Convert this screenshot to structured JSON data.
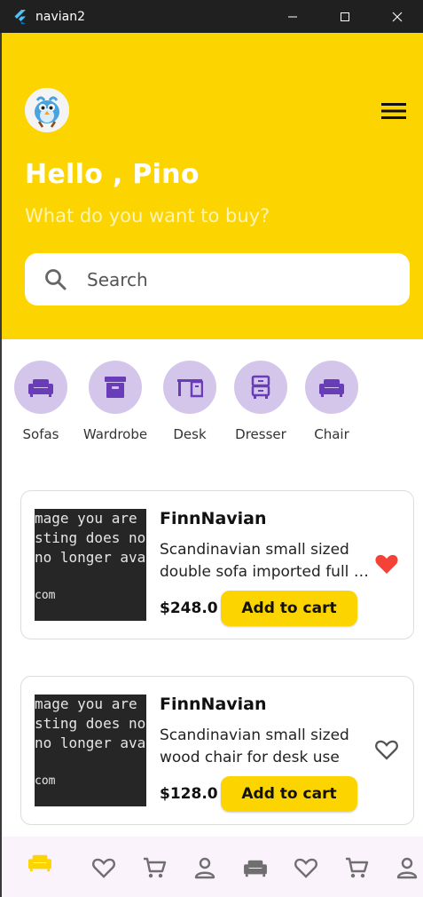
{
  "window": {
    "title": "navian2"
  },
  "header": {
    "greeting": "Hello , Pino",
    "subtitle": "What do you want to buy?",
    "search_placeholder": "Search",
    "background_color": "#FCD400"
  },
  "categories": [
    {
      "label": "Sofas",
      "icon": "sofa-icon"
    },
    {
      "label": "Wardrobe",
      "icon": "wardrobe-icon"
    },
    {
      "label": "Desk",
      "icon": "desk-icon"
    },
    {
      "label": "Dresser",
      "icon": "dresser-icon"
    },
    {
      "label": "Chair",
      "icon": "chair-icon"
    }
  ],
  "image_placeholder_text": [
    "mage you are",
    "sting does no",
    "no longer avail",
    "com"
  ],
  "products": [
    {
      "name": "FinnNavian",
      "description_lines": [
        "Scandinavian small sized",
        "double sofa imported full le..."
      ],
      "price": "$248.0",
      "cart_label": "Add to cart",
      "favorite": true
    },
    {
      "name": "FinnNavian",
      "description_lines": [
        "Scandinavian small sized",
        "wood chair for desk use"
      ],
      "price": "$128.0",
      "cart_label": "Add to cart",
      "favorite": false
    }
  ],
  "bottom_nav": [
    {
      "icon": "sofa-icon",
      "active": true
    },
    {
      "icon": "heart-icon",
      "active": false
    },
    {
      "icon": "cart-icon",
      "active": false
    },
    {
      "icon": "person-icon",
      "active": false
    },
    {
      "icon": "sofa-icon",
      "active": false
    },
    {
      "icon": "heart-icon",
      "active": false
    },
    {
      "icon": "cart-icon",
      "active": false
    },
    {
      "icon": "person-icon",
      "active": false
    }
  ],
  "colors": {
    "accent": "#FCD400",
    "category_circle": "#D4C6EA",
    "category_icon": "#6A3DB8",
    "favorite": "#F44336",
    "nav_active": "#FCD400",
    "nav_inactive": "#6F6F6F"
  }
}
